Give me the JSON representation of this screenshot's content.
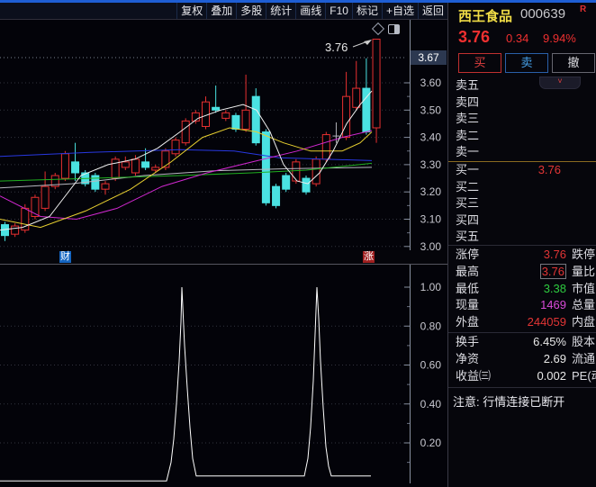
{
  "accent_colors": {
    "up_red": "#e23535",
    "down_green": "#2ecc40",
    "magenta": "#d84ad8",
    "neutral_white": "#e8e8e8",
    "candle_up": "#e83030",
    "candle_down": "#4ae2e2",
    "doji_gray": "#b0b0b8",
    "name_yellow": "#f0dc46",
    "price_red": "#f03030",
    "buy_red": "#e04040",
    "sell_blue": "#46a0e8",
    "top_bar_blue": "#1e5ed4"
  },
  "icons": {
    "marker_diamond": "diamond-outline",
    "panel_toggle": "split-rectangle",
    "collapse_chevron": "v"
  },
  "toolbar": {
    "items": [
      "复权",
      "叠加",
      "多股",
      "统计",
      "画线",
      "F10",
      "标记",
      "+自选",
      "返回"
    ]
  },
  "badges": {
    "left": "财",
    "right": "涨"
  },
  "stock": {
    "name": "西王食品",
    "code": "000639",
    "flag": "R",
    "price": "3.76",
    "change": "0.34",
    "change_pct": "9.94%"
  },
  "trade_buttons": {
    "buy": "买",
    "sell": "卖",
    "cancel": "撤"
  },
  "order_book": {
    "sell_rows": [
      {
        "label": "卖五",
        "value": ""
      },
      {
        "label": "卖四",
        "value": ""
      },
      {
        "label": "卖三",
        "value": ""
      },
      {
        "label": "卖二",
        "value": ""
      },
      {
        "label": "卖一",
        "value": ""
      }
    ],
    "buy_rows": [
      {
        "label": "买一",
        "value": "3.76"
      },
      {
        "label": "买二",
        "value": ""
      },
      {
        "label": "买三",
        "value": ""
      },
      {
        "label": "买四",
        "value": ""
      },
      {
        "label": "买五",
        "value": ""
      }
    ]
  },
  "stats_group_1": [
    {
      "label": "涨停",
      "value": "3.76",
      "color": "up_red",
      "boxed": false,
      "label2": "跌停"
    },
    {
      "label": "最高",
      "value": "3.76",
      "color": "up_red",
      "boxed": true,
      "label2": "量比"
    },
    {
      "label": "最低",
      "value": "3.38",
      "color": "down_green",
      "boxed": false,
      "label2": "市值"
    },
    {
      "label": "现量",
      "value": "1469",
      "color": "magenta",
      "boxed": false,
      "label2": "总量"
    },
    {
      "label": "外盘",
      "value": "244059",
      "color": "up_red",
      "boxed": false,
      "label2": "内盘"
    }
  ],
  "stats_group_2": [
    {
      "label": "换手",
      "value": "6.45%",
      "color": "neutral_white",
      "boxed": false,
      "label2": "股本"
    },
    {
      "label": "净资",
      "value": "2.69",
      "color": "neutral_white",
      "boxed": false,
      "label2": "流通"
    },
    {
      "label": "收益㈢",
      "value": "0.002",
      "color": "neutral_white",
      "boxed": false,
      "label2": "PE(动)"
    }
  ],
  "notice": "注意: 行情连接已断开",
  "chart_data": [
    {
      "type": "candlestick",
      "title": "daily candlestick with moving averages",
      "ylim": [
        3.0,
        3.78
      ],
      "y_ticks": [
        "3.60",
        "3.50",
        "3.40",
        "3.30",
        "3.20",
        "3.10",
        "3.00"
      ],
      "current_axis_label": "3.67",
      "annotation": {
        "text": "3.76",
        "points_to_high": 3.76
      },
      "grid": "dotted-horizontal",
      "candles": [
        {
          "o": 3.08,
          "c": 3.04,
          "l": 3.02,
          "h": 3.09,
          "k": "d"
        },
        {
          "o": 3.045,
          "c": 3.075,
          "l": 3.035,
          "h": 3.085,
          "k": "u"
        },
        {
          "o": 3.06,
          "c": 3.14,
          "l": 3.05,
          "h": 3.155,
          "k": "u"
        },
        {
          "o": 3.11,
          "c": 3.18,
          "l": 3.1,
          "h": 3.19,
          "k": "u"
        },
        {
          "o": 3.14,
          "c": 3.22,
          "l": 3.13,
          "h": 3.275,
          "k": "u"
        },
        {
          "o": 3.22,
          "c": 3.26,
          "l": 3.21,
          "h": 3.27,
          "k": "u"
        },
        {
          "o": 3.25,
          "c": 3.34,
          "l": 3.24,
          "h": 3.35,
          "k": "u"
        },
        {
          "o": 3.31,
          "c": 3.27,
          "l": 3.24,
          "h": 3.38,
          "k": "d"
        },
        {
          "o": 3.27,
          "c": 3.23,
          "l": 3.22,
          "h": 3.28,
          "k": "d"
        },
        {
          "o": 3.26,
          "c": 3.21,
          "l": 3.2,
          "h": 3.27,
          "k": "d"
        },
        {
          "o": 3.21,
          "c": 3.23,
          "l": 3.19,
          "h": 3.24,
          "k": "u"
        },
        {
          "o": 3.25,
          "c": 3.32,
          "l": 3.24,
          "h": 3.33,
          "k": "u"
        },
        {
          "o": 3.29,
          "c": 3.31,
          "l": 3.28,
          "h": 3.33,
          "k": "u"
        },
        {
          "o": 3.27,
          "c": 3.32,
          "l": 3.26,
          "h": 3.335,
          "k": "u"
        },
        {
          "o": 3.31,
          "c": 3.29,
          "l": 3.28,
          "h": 3.36,
          "k": "d"
        },
        {
          "o": 3.28,
          "c": 3.29,
          "l": 3.27,
          "h": 3.3,
          "k": "u"
        },
        {
          "o": 3.29,
          "c": 3.35,
          "l": 3.28,
          "h": 3.36,
          "k": "u"
        },
        {
          "o": 3.34,
          "c": 3.39,
          "l": 3.33,
          "h": 3.4,
          "k": "u"
        },
        {
          "o": 3.38,
          "c": 3.46,
          "l": 3.37,
          "h": 3.47,
          "k": "u"
        },
        {
          "o": 3.46,
          "c": 3.49,
          "l": 3.45,
          "h": 3.5,
          "k": "u"
        },
        {
          "o": 3.44,
          "c": 3.53,
          "l": 3.43,
          "h": 3.55,
          "k": "u"
        },
        {
          "o": 3.51,
          "c": 3.5,
          "l": 3.49,
          "h": 3.59,
          "k": "d"
        },
        {
          "o": 3.47,
          "c": 3.49,
          "l": 3.46,
          "h": 3.5,
          "k": "u"
        },
        {
          "o": 3.48,
          "c": 3.43,
          "l": 3.42,
          "h": 3.49,
          "k": "d"
        },
        {
          "o": 3.43,
          "c": 3.5,
          "l": 3.42,
          "h": 3.63,
          "k": "u"
        },
        {
          "o": 3.55,
          "c": 3.38,
          "l": 3.37,
          "h": 3.58,
          "k": "d"
        },
        {
          "o": 3.42,
          "c": 3.16,
          "l": 3.15,
          "h": 3.43,
          "k": "d"
        },
        {
          "o": 3.22,
          "c": 3.15,
          "l": 3.14,
          "h": 3.23,
          "k": "d"
        },
        {
          "o": 3.26,
          "c": 3.21,
          "l": 3.2,
          "h": 3.27,
          "k": "d"
        },
        {
          "o": 3.24,
          "c": 3.31,
          "l": 3.23,
          "h": 3.32,
          "k": "u"
        },
        {
          "o": 3.25,
          "c": 3.2,
          "l": 3.19,
          "h": 3.26,
          "k": "d"
        },
        {
          "o": 3.23,
          "c": 3.32,
          "l": 3.22,
          "h": 3.33,
          "k": "u"
        },
        {
          "o": 3.32,
          "c": 3.41,
          "l": 3.31,
          "h": 3.42,
          "k": "u"
        },
        {
          "o": 3.4,
          "c": 3.405,
          "l": 3.38,
          "h": 3.455,
          "k": "j"
        },
        {
          "o": 3.4,
          "c": 3.55,
          "l": 3.39,
          "h": 3.64,
          "k": "u"
        },
        {
          "o": 3.51,
          "c": 3.58,
          "l": 3.5,
          "h": 3.68,
          "k": "u"
        },
        {
          "o": 3.58,
          "c": 3.42,
          "l": 3.41,
          "h": 3.69,
          "k": "d"
        },
        {
          "o": 3.435,
          "c": 3.76,
          "l": 3.38,
          "h": 3.76,
          "k": "u"
        }
      ],
      "ma_lines": [
        {
          "name": "ma-gray",
          "color": "#b8b8c0",
          "points": [
            [
              0,
              3.215
            ],
            [
              80,
              3.23
            ],
            [
              160,
              3.26
            ],
            [
              240,
              3.278
            ],
            [
              320,
              3.285
            ],
            [
              413,
              3.29
            ]
          ]
        },
        {
          "name": "ma-green",
          "color": "#20b020",
          "points": [
            [
              0,
              3.24
            ],
            [
              100,
              3.25
            ],
            [
              200,
              3.26
            ],
            [
              280,
              3.27
            ],
            [
              340,
              3.28
            ],
            [
              413,
              3.305
            ]
          ]
        },
        {
          "name": "ma-blue",
          "color": "#2838e0",
          "points": [
            [
              0,
              3.33
            ],
            [
              100,
              3.345
            ],
            [
              200,
              3.355
            ],
            [
              260,
              3.35
            ],
            [
              310,
              3.325
            ],
            [
              413,
              3.315
            ]
          ]
        },
        {
          "name": "ma-magenta",
          "color": "#d028d0",
          "points": [
            [
              0,
              3.185
            ],
            [
              45,
              3.11
            ],
            [
              85,
              3.1
            ],
            [
              130,
              3.14
            ],
            [
              180,
              3.22
            ],
            [
              230,
              3.27
            ],
            [
              280,
              3.31
            ],
            [
              330,
              3.35
            ],
            [
              380,
              3.4
            ],
            [
              413,
              3.425
            ]
          ]
        },
        {
          "name": "ma-yellow",
          "color": "#e8d030",
          "points": [
            [
              0,
              3.1
            ],
            [
              45,
              3.07
            ],
            [
              95,
              3.13
            ],
            [
              145,
              3.21
            ],
            [
              190,
              3.31
            ],
            [
              225,
              3.4
            ],
            [
              255,
              3.435
            ],
            [
              285,
              3.42
            ],
            [
              315,
              3.38
            ],
            [
              345,
              3.35
            ],
            [
              380,
              3.35
            ],
            [
              400,
              3.38
            ],
            [
              413,
              3.42
            ]
          ]
        },
        {
          "name": "ma-white",
          "color": "#f0f0f0",
          "points": [
            [
              0,
              3.06
            ],
            [
              25,
              3.07
            ],
            [
              55,
              3.11
            ],
            [
              90,
              3.26
            ],
            [
              120,
              3.3
            ],
            [
              150,
              3.32
            ],
            [
              175,
              3.36
            ],
            [
              200,
              3.42
            ],
            [
              220,
              3.47
            ],
            [
              245,
              3.5
            ],
            [
              270,
              3.52
            ],
            [
              285,
              3.5
            ],
            [
              300,
              3.42
            ],
            [
              315,
              3.3
            ],
            [
              330,
              3.24
            ],
            [
              342,
              3.23
            ],
            [
              355,
              3.27
            ],
            [
              370,
              3.35
            ],
            [
              385,
              3.45
            ],
            [
              400,
              3.52
            ],
            [
              413,
              3.57
            ]
          ]
        }
      ]
    },
    {
      "type": "line",
      "title": "signal indicator with two spikes",
      "ylim": [
        0,
        1.05
      ],
      "y_ticks": [
        "1.00",
        "0.80",
        "0.60",
        "0.40",
        "0.20"
      ],
      "color": "#ffffff",
      "points": [
        [
          0,
          0.005
        ],
        [
          185,
          0.005
        ],
        [
          190,
          0.1
        ],
        [
          193,
          0.22
        ],
        [
          196,
          0.4
        ],
        [
          199,
          0.62
        ],
        [
          201,
          0.82
        ],
        [
          202,
          1.0
        ],
        [
          203,
          0.9
        ],
        [
          205,
          0.7
        ],
        [
          208,
          0.48
        ],
        [
          211,
          0.28
        ],
        [
          214,
          0.12
        ],
        [
          218,
          0.03
        ],
        [
          338,
          0.03
        ],
        [
          342,
          0.12
        ],
        [
          345,
          0.28
        ],
        [
          348,
          0.52
        ],
        [
          350,
          0.76
        ],
        [
          352,
          1.0
        ],
        [
          354,
          0.84
        ],
        [
          356,
          0.62
        ],
        [
          359,
          0.38
        ],
        [
          362,
          0.18
        ],
        [
          365,
          0.08
        ],
        [
          368,
          0.03
        ],
        [
          412,
          0.03
        ]
      ]
    }
  ]
}
